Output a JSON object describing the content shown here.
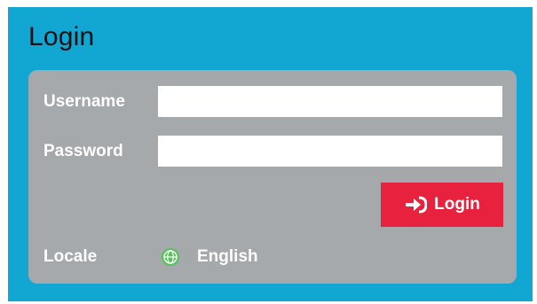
{
  "window": {
    "title": "Login"
  },
  "form": {
    "username_label": "Username",
    "username_value": "",
    "password_label": "Password",
    "password_value": "",
    "login_button_label": "Login",
    "locale_label": "Locale",
    "locale_value": "English",
    "locale_icon": "globe-icon"
  },
  "colors": {
    "panel_bg": "#12a6d3",
    "card_bg": "#a5a9ab",
    "button_bg": "#e8213f",
    "locale_icon_color": "#58c25a"
  }
}
